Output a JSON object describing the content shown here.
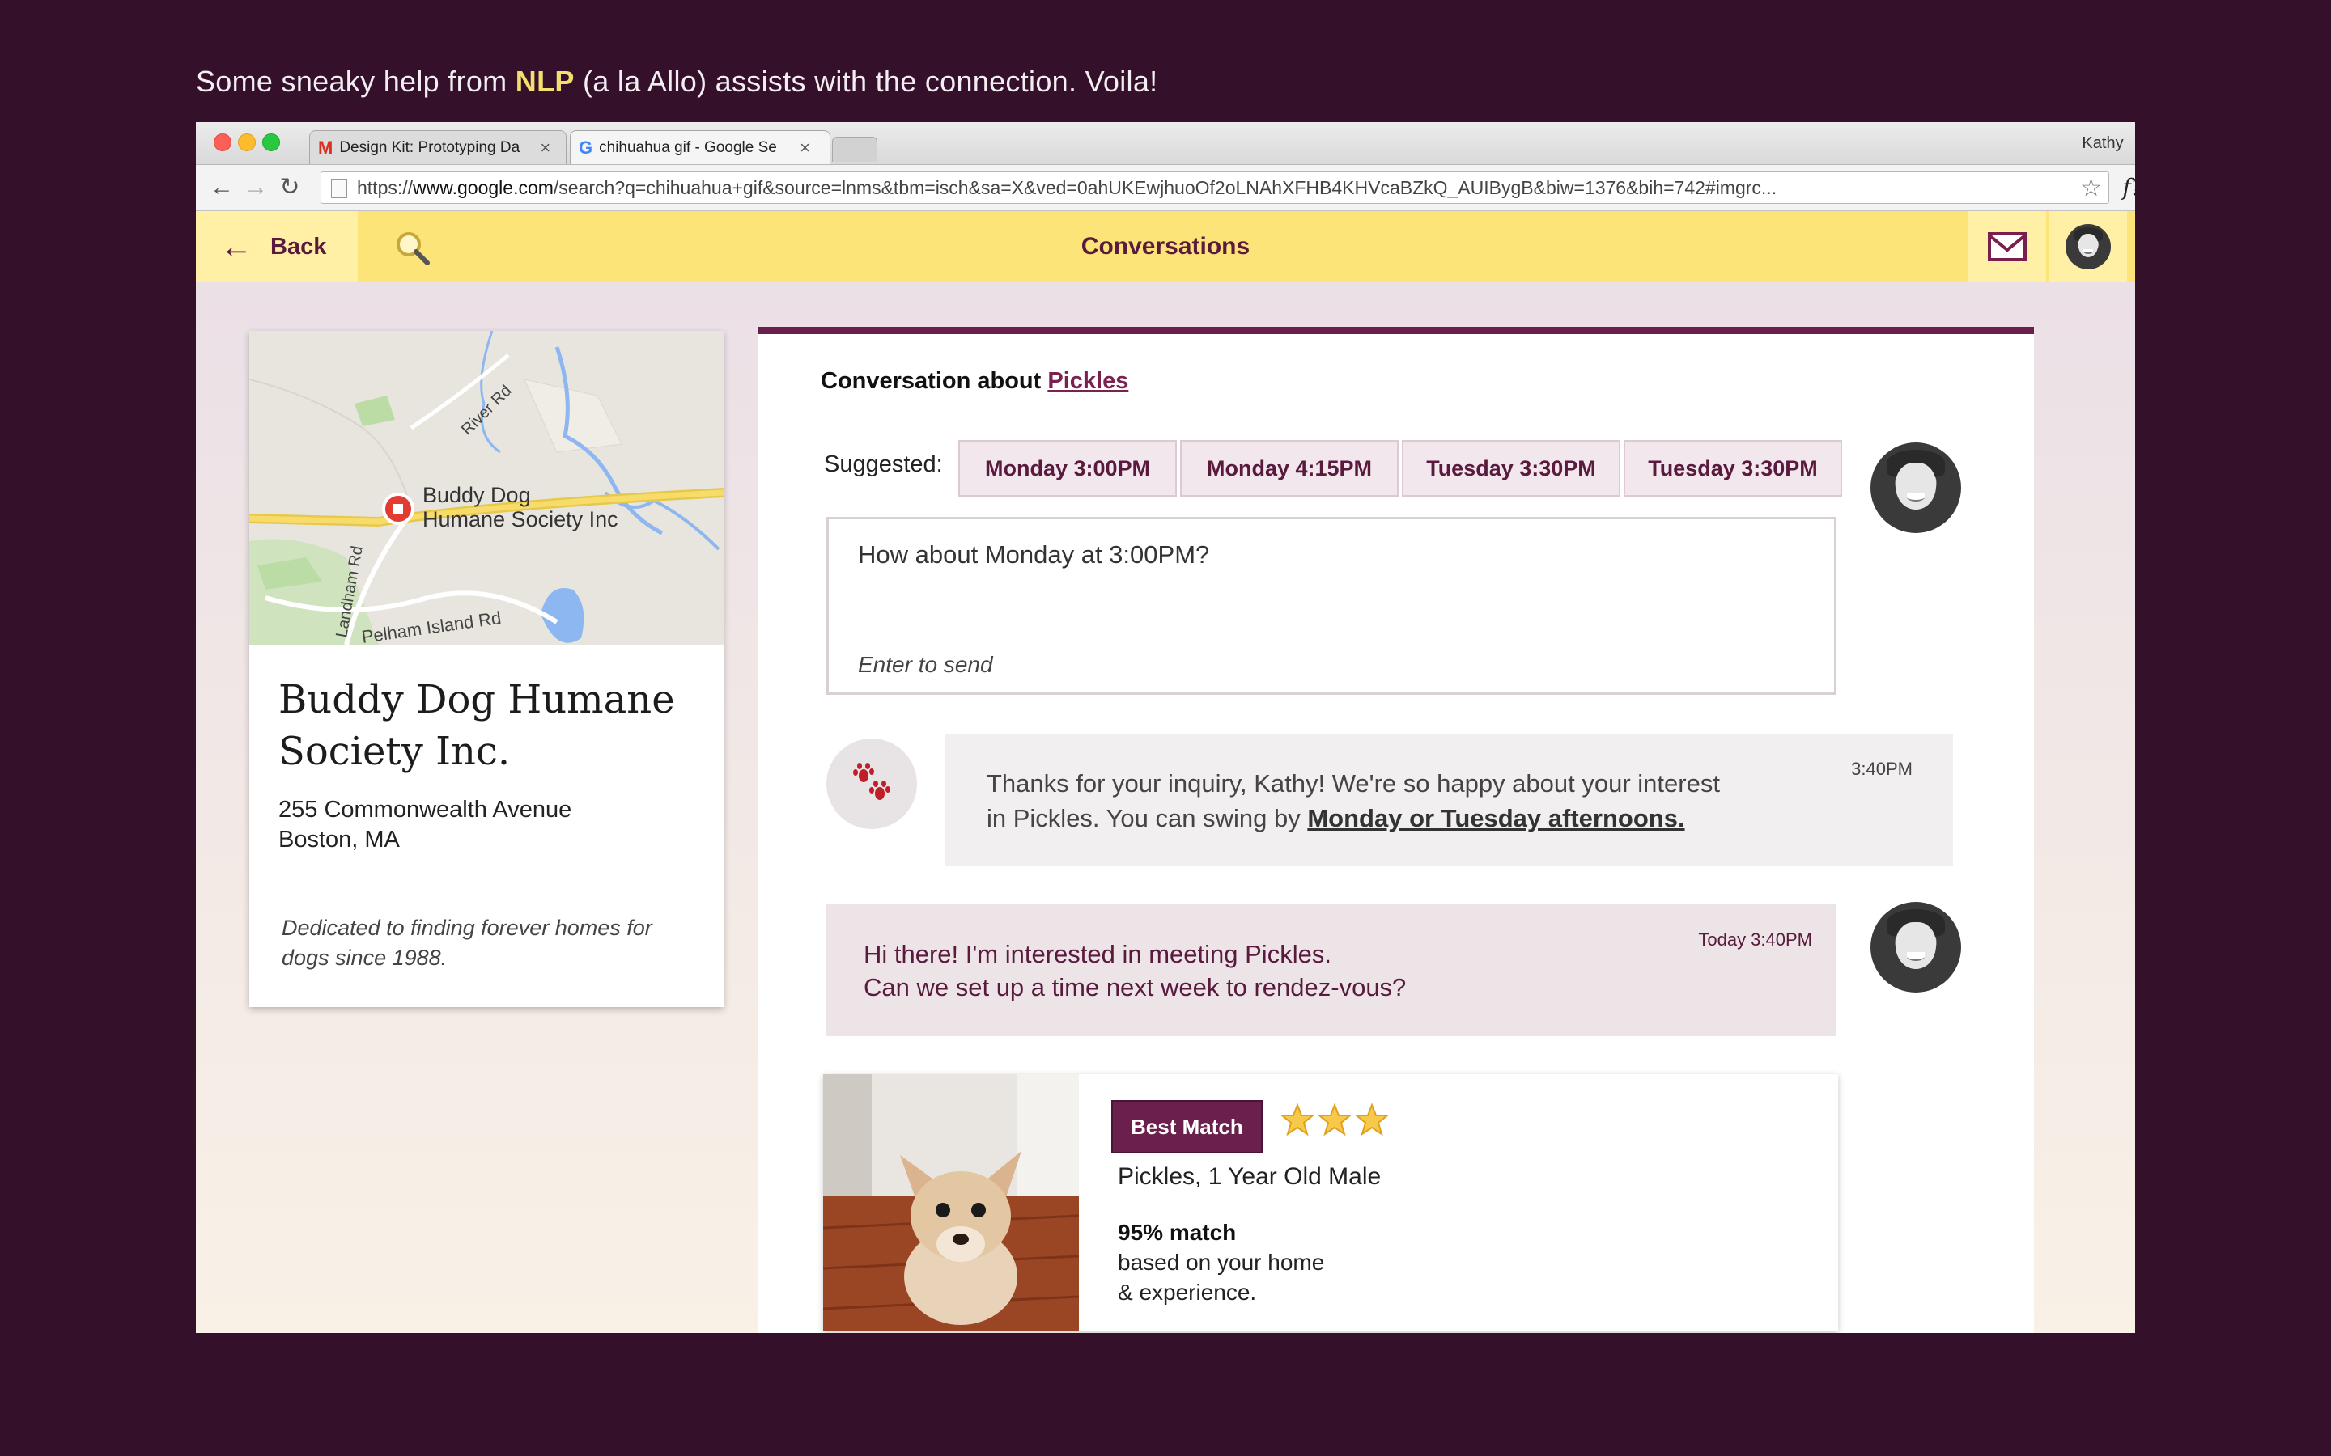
{
  "caption": {
    "prefix": "Some sneaky help from ",
    "highlight": "NLP",
    "suffix": " (a la Allo) assists with the connection. Voila!"
  },
  "browser": {
    "tabs": [
      {
        "title": "Design Kit: Prototyping Da",
        "favicon": "gmail-icon"
      },
      {
        "title": "chihuahua gif - Google Se",
        "favicon": "google-icon",
        "active": true
      }
    ],
    "profile": "Kathy",
    "url": {
      "prefix": "https://",
      "domain": "www.google.com",
      "path": "/search?q=chihuahua+gif&source=lnms&tbm=isch&sa=X&ved=0ahUKEwjhuoOf2oLNAhXFHB4KHVcaBZkQ_AUIBygB&biw=1376&bih=742#imgrc..."
    },
    "extensions": [
      "font-finder-icon",
      "opera-icon",
      "camera-icon",
      "settings-icon",
      "menu-icon"
    ]
  },
  "app": {
    "back_label": "Back",
    "title": "Conversations"
  },
  "organization": {
    "name": "Buddy Dog Humane Society Inc.",
    "address_line1": "255 Commonwealth Avenue",
    "address_line2": "Boston, MA",
    "tagline": "Dedicated to finding forever homes for dogs since 1988.",
    "map": {
      "marker_label_line1": "Buddy Dog",
      "marker_label_line2": "Humane Society Inc",
      "road_labels": [
        "River Rd",
        "Landham Rd",
        "Pelham Island Rd"
      ]
    }
  },
  "conversation": {
    "title_prefix": "Conversation about ",
    "pet_link": "Pickles",
    "suggested_label": "Suggested:",
    "suggestions": [
      "Monday 3:00PM",
      "Monday 4:15PM",
      "Tuesday 3:30PM",
      "Tuesday 3:30PM"
    ],
    "composer_text": "How about Monday at 3:00PM?",
    "composer_hint": "Enter to send",
    "messages": [
      {
        "sender": "shelter",
        "time": "3:40PM",
        "text_line1": "Thanks for your inquiry, Kathy! We're so happy about your interest",
        "text_line2_prefix": "in Pickles. You can swing by ",
        "text_line2_link": "Monday or Tuesday afternoons."
      },
      {
        "sender": "user",
        "time": "Today 3:40PM",
        "text_line1": "Hi there! I'm interested in meeting Pickles.",
        "text_line2": "Can we set up a time next week to rendez-vous?"
      }
    ],
    "match": {
      "badge": "Best Match",
      "stars": 3,
      "pet_line": "Pickles, 1 Year Old Male",
      "percent": "95% match",
      "desc_line1": "based on your home",
      "desc_line2": "& experience."
    }
  },
  "colors": {
    "background": "#35102a",
    "header_yellow": "#fde479",
    "brand_plum": "#6a1f4d",
    "caption_highlight": "#f5df6c"
  }
}
